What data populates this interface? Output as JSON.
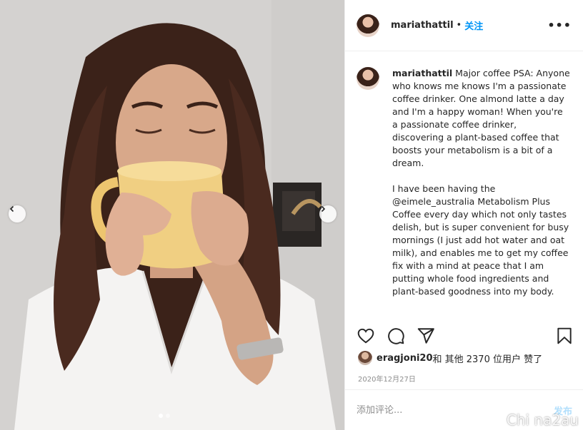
{
  "post": {
    "username": "mariathattil",
    "follow_label": "关注",
    "separator": "•",
    "more_label": "•••",
    "caption_user": "mariathattil",
    "caption_p1": "Major coffee PSA: Anyone who knows me knows I'm a passionate coffee drinker. One almond latte a day and I'm a happy woman! When you're a passionate coffee drinker, discovering a plant-based coffee that boosts your metabolism is a bit of a dream.",
    "caption_p2": "I have been having the @eimele_australia Metabolism Plus Coffee every day which not only tastes delish, but is super convenient for busy mornings (I just add hot water and oat milk), and enables me to get my coffee fix with a mind at peace that I am putting whole food ingredients and plant-based goodness into my body.",
    "likes_user": "eragjoni20",
    "likes_rest": " 和 其他 2370 位用户 赞了",
    "date": "2020年12月27日",
    "comment_placeholder": "添加评论...",
    "post_label": "发布"
  },
  "icons": {
    "like": "heart-icon",
    "comment": "comment-icon",
    "share": "paper-plane-icon",
    "save": "bookmark-icon",
    "prev": "chevron-left-icon",
    "next": "chevron-right-icon"
  },
  "colors": {
    "link": "#0095f6",
    "post_disabled": "#b2dffc",
    "muted": "#8e8e8e"
  },
  "watermark": "Chi na2au"
}
